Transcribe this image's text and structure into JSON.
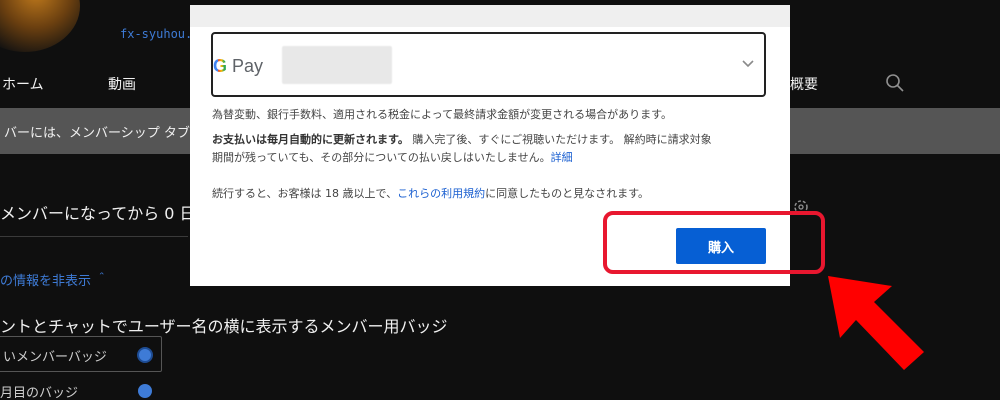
{
  "background": {
    "channel_handle": "fx-syuhou.t",
    "nav": [
      {
        "label": "ホーム"
      },
      {
        "label": "動画"
      },
      {
        "label": "概要"
      }
    ],
    "banner_text": "バーには、メンバーシップ タブ",
    "days_text": "メンバーになってから 0 日",
    "hide_info_link": "の情報を非表示 ＾",
    "badge_heading": "ントとチャットでユーザー名の横に表示するメンバー用バッジ",
    "badge_option": "いメンバーバッジ",
    "badge_option2": "月目のバッジ"
  },
  "dialog": {
    "payment_method": {
      "brand_g": "G",
      "brand_text": " Pay"
    },
    "notice_price": "為替変動、銀行手数料、適用される税金によって最終請求金額が変更される場合があります。",
    "notice_renew_bold": "お支払いは毎月自動的に更新されます。",
    "notice_renew_rest": " 購入完了後、すぐにご視聴いただけます。 解約時に請求対象",
    "notice_renew_line2": "期間が残っていても、その部分についての払い戻しはいたしません。",
    "notice_details_link": "詳細",
    "terms_prefix": "続行すると、お客様は 18 歳以上で、",
    "terms_link": "これらの利用規約",
    "terms_suffix": "に同意したものと見なされます。",
    "buy_button": "購入"
  },
  "annotation": {
    "highlight_color": "#e8172f",
    "arrow_color": "#ff0000"
  }
}
